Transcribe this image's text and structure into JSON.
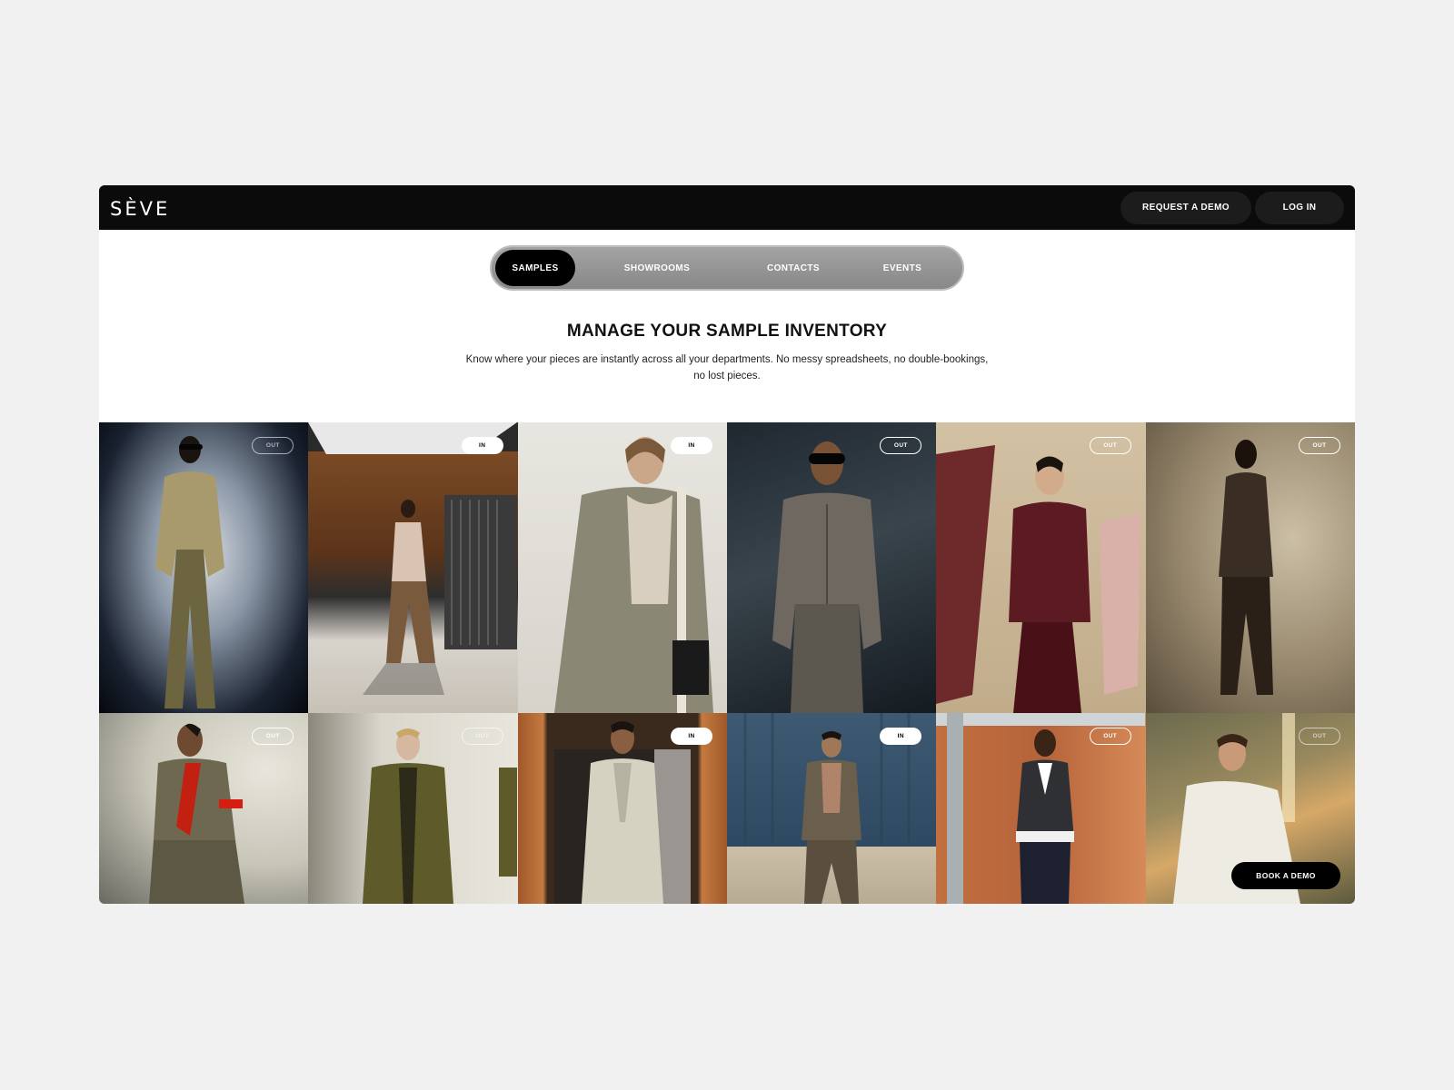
{
  "brand": {
    "logo": "SÈVE"
  },
  "header": {
    "request_demo": "REQUEST A DEMO",
    "login": "LOG IN"
  },
  "tabs": [
    "SAMPLES",
    "SHOWROOMS",
    "CONTACTS",
    "EVENTS"
  ],
  "hero": {
    "title": "MANAGE YOUR SAMPLE INVENTORY",
    "subtitle": "Know where your pieces are instantly across all your departments. No messy spreadsheets, no double-bookings, no lost pieces."
  },
  "gallery": {
    "tiles": [
      {
        "status": "OUT"
      },
      {
        "status": "IN"
      },
      {
        "status": "IN"
      },
      {
        "status": "OUT"
      },
      {
        "status": "OUT"
      },
      {
        "status": "OUT"
      },
      {
        "status": "OUT"
      },
      {
        "status": "OUT"
      },
      {
        "status": "IN"
      },
      {
        "status": "IN"
      },
      {
        "status": "OUT"
      },
      {
        "status": "OUT"
      }
    ],
    "book_demo": "BOOK A DEMO"
  }
}
